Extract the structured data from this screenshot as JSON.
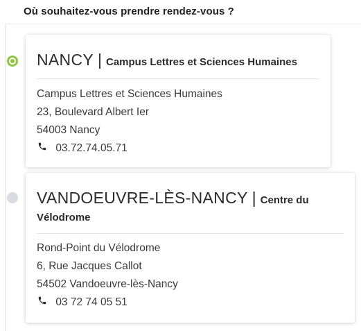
{
  "header": {
    "question": "Où souhaitez-vous prendre rendez-vous ?"
  },
  "locations": [
    {
      "city": "NANCY",
      "separator": "|",
      "campus": "Campus Lettres et Sciences Humaines",
      "selected": true,
      "address": {
        "line1": "Campus Lettres et Sciences Humaines",
        "line2": "23, Boulevard Albert Ier",
        "line3": "54003 Nancy"
      },
      "phone": "03.72.74.05.71",
      "phone_icon": "phone-icon"
    },
    {
      "city": "VANDOEUVRE-LÈS-NANCY",
      "separator": "|",
      "campus": "Centre du Vélodrome",
      "selected": false,
      "address": {
        "line1": "Rond-Point du Vélodrome",
        "line2": "6, Rue Jacques Callot",
        "line3": "54502 Vandoeuvre-lès-Nancy"
      },
      "phone": "03 72 74 05 51",
      "phone_icon": "phone-icon"
    }
  ],
  "colors": {
    "selected_radio": "#8cc640",
    "unselected_radio": "#d9dbe0"
  }
}
